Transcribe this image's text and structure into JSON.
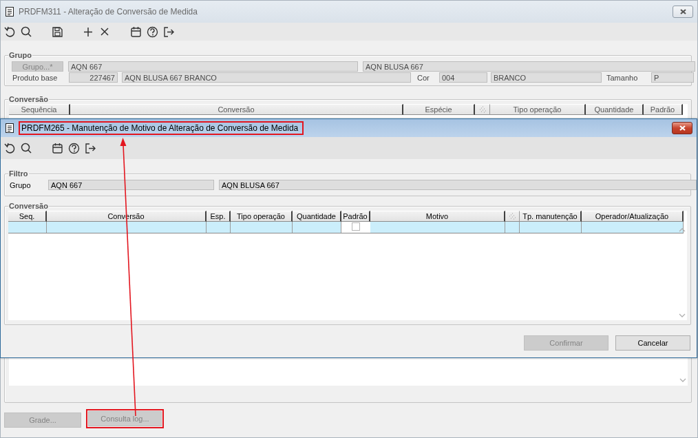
{
  "main_window": {
    "title": "PRDFM311 - Alteração de Conversão de Medida",
    "grupo": {
      "legend": "Grupo",
      "button": {
        "label": "Grupo...*",
        "disabled": true
      },
      "code": "AQN 667",
      "description": "AQN BLUSA 667"
    },
    "produto_base": {
      "label": "Produto base",
      "code": "227467",
      "description": "AQN BLUSA 667 BRANCO"
    },
    "cor": {
      "label": "Cor",
      "code": "004",
      "description": "BRANCO"
    },
    "tamanho": {
      "label": "Tamanho",
      "value": "P"
    },
    "conversao": {
      "legend": "Conversão",
      "columns": [
        {
          "kind": "text",
          "label": "Sequência"
        },
        {
          "kind": "text",
          "label": "Conversão"
        },
        {
          "kind": "text",
          "label": "Espécie"
        },
        {
          "kind": "icon"
        },
        {
          "kind": "text",
          "label": "Tipo operação"
        },
        {
          "kind": "text",
          "label": "Quantidade"
        },
        {
          "kind": "text",
          "label": "Padrão"
        }
      ]
    },
    "buttons": [
      {
        "label": "Grade...",
        "disabled": true,
        "highlighted": false
      },
      {
        "label": "Consulta log...",
        "disabled": true,
        "highlighted": true
      }
    ]
  },
  "dialog": {
    "title": "PRDFM265 - Manutenção de Motivo de Alteração de Conversão de Medida",
    "title_highlighted": true,
    "filtro": {
      "legend": "Filtro",
      "label": "Grupo",
      "code": "AQN 667",
      "description": "AQN BLUSA 667"
    },
    "conversao": {
      "legend": "Conversão",
      "columns": [
        {
          "kind": "text",
          "label": "Seq."
        },
        {
          "kind": "text",
          "label": "Conversão"
        },
        {
          "kind": "text",
          "label": "Esp."
        },
        {
          "kind": "text",
          "label": "Tipo operação"
        },
        {
          "kind": "text",
          "label": "Quantidade"
        },
        {
          "kind": "check",
          "label": "Padrão"
        },
        {
          "kind": "text",
          "label": "Motivo"
        },
        {
          "kind": "icon"
        },
        {
          "kind": "text",
          "label": "Tp. manutenção"
        },
        {
          "kind": "text",
          "label": "Operador/Atualização"
        }
      ],
      "rows": [
        {
          "selected": true,
          "padrao_checked": false
        }
      ]
    },
    "buttons": [
      {
        "label": "Confirmar",
        "disabled": true
      },
      {
        "label": "Cancelar",
        "disabled": false
      }
    ]
  },
  "annotation_arrow": true
}
